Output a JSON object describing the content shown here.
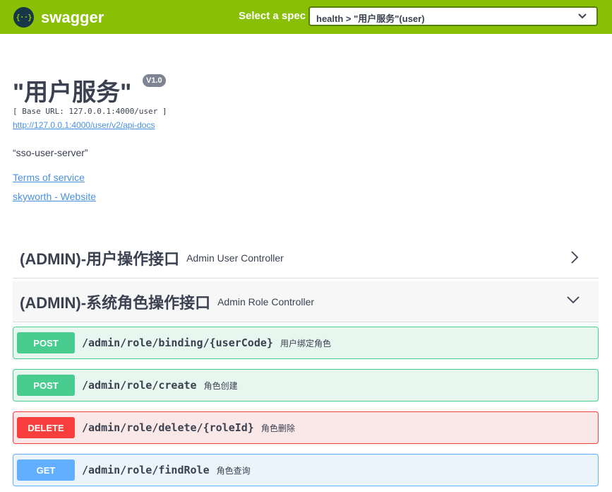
{
  "topbar": {
    "logo_icon_text": "{··}",
    "logo_text": "swagger",
    "spec_label": "Select a spec",
    "spec_selected": "health > \"用户服务\"(user)"
  },
  "info": {
    "title": "\"用户服务\"",
    "version": "V1.0",
    "base_url": "[ Base URL: 127.0.0.1:4000/user ]",
    "api_docs_link": "http://127.0.0.1:4000/user/v2/api-docs",
    "description": "“sso-user-server”",
    "terms_link": "Terms of service",
    "website_link": "skyworth - Website"
  },
  "tags": [
    {
      "name": "(ADMIN)-用户操作接口",
      "description": "Admin User Controller",
      "expanded": false
    },
    {
      "name": "(ADMIN)-系统角色操作接口",
      "description": "Admin Role Controller",
      "expanded": true
    }
  ],
  "operations": [
    {
      "method": "POST",
      "path": "/admin/role/binding/{userCode}",
      "summary": "用户绑定角色"
    },
    {
      "method": "POST",
      "path": "/admin/role/create",
      "summary": "角色创建"
    },
    {
      "method": "DELETE",
      "path": "/admin/role/delete/{roleId}",
      "summary": "角色删除"
    },
    {
      "method": "GET",
      "path": "/admin/role/findRole",
      "summary": "角色查询"
    }
  ],
  "colors": {
    "topbar": "#89bf04",
    "post": "#49cc90",
    "delete": "#f93e3e",
    "get": "#61affe",
    "link": "#4990e2"
  }
}
